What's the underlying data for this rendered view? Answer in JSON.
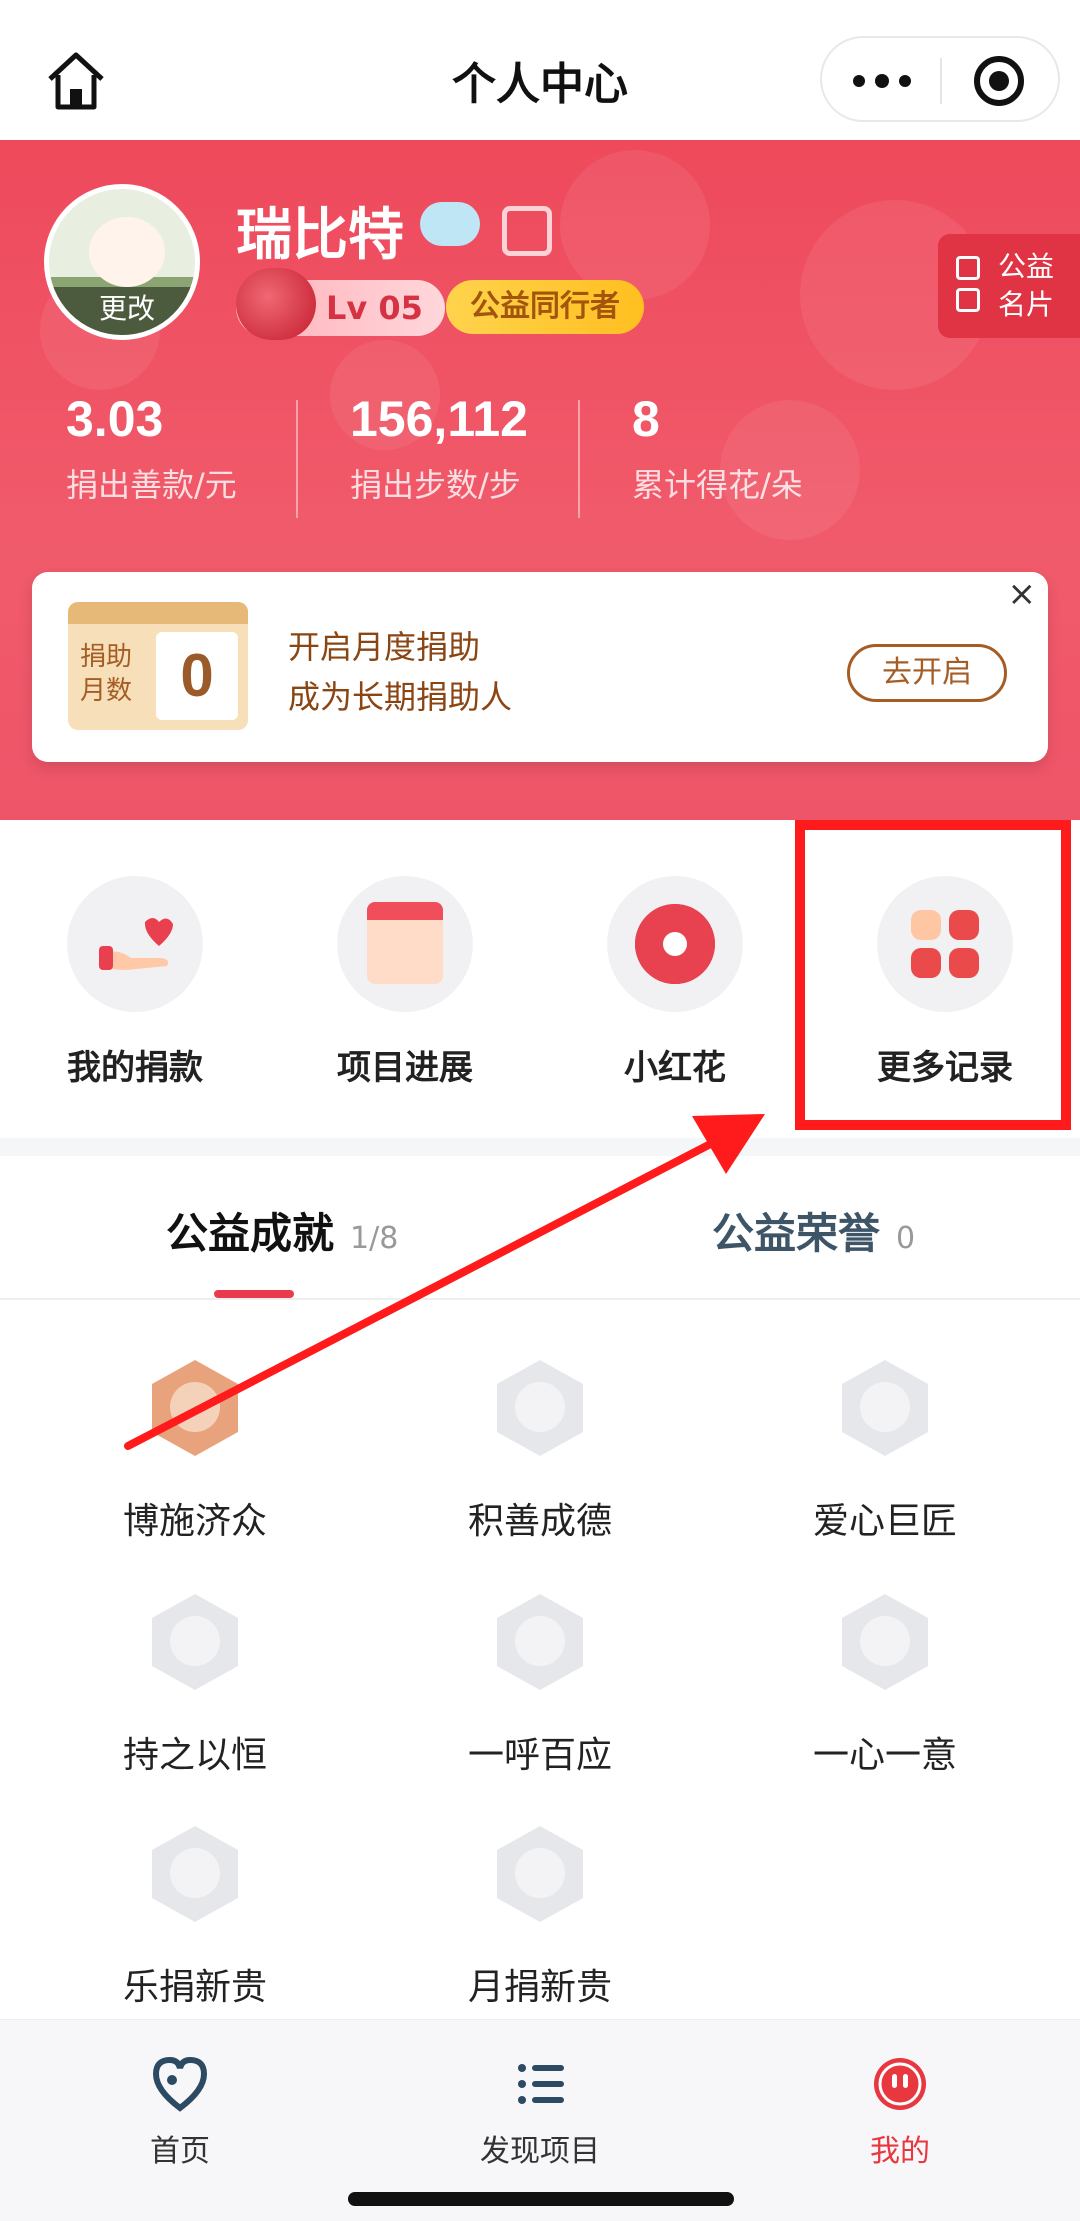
{
  "nav": {
    "title": "个人中心"
  },
  "profile": {
    "username": "瑞比特",
    "avatar_change": "更改",
    "level": "Lv 05",
    "title_badge": "公益同行者",
    "card_button": [
      "公益",
      "名片"
    ]
  },
  "stats": [
    {
      "value": "3.03",
      "label": "捐出善款/元"
    },
    {
      "value": "156,112",
      "label": "捐出步数/步"
    },
    {
      "value": "8",
      "label": "累计得花/朵"
    }
  ],
  "promo": {
    "calendar_label": [
      "捐助",
      "月数"
    ],
    "calendar_value": "0",
    "line1": "开启月度捐助",
    "line2": "成为长期捐助人",
    "button": "去开启",
    "close": "×"
  },
  "quick": [
    {
      "label": "我的捐款",
      "icon": "heart-hand-icon"
    },
    {
      "label": "项目进展",
      "icon": "calendar-icon"
    },
    {
      "label": "小红花",
      "icon": "red-flower-icon"
    },
    {
      "label": "更多记录",
      "icon": "grid-icon"
    }
  ],
  "tabs": [
    {
      "label": "公益成就",
      "count": "1/8",
      "active": true
    },
    {
      "label": "公益荣誉",
      "count": "0",
      "active": false
    }
  ],
  "achievements": [
    {
      "label": "博施济众",
      "unlocked": true
    },
    {
      "label": "积善成德",
      "unlocked": false
    },
    {
      "label": "爱心巨匠",
      "unlocked": false
    },
    {
      "label": "持之以恒",
      "unlocked": false
    },
    {
      "label": "一呼百应",
      "unlocked": false
    },
    {
      "label": "一心一意",
      "unlocked": false
    },
    {
      "label": "乐捐新贵",
      "unlocked": false
    },
    {
      "label": "月捐新贵",
      "unlocked": false
    }
  ],
  "tabbar": [
    {
      "label": "首页",
      "icon": "heart-home-icon",
      "active": false
    },
    {
      "label": "发现项目",
      "icon": "list-icon",
      "active": false
    },
    {
      "label": "我的",
      "icon": "face-icon",
      "active": true
    }
  ],
  "colors": {
    "brand_red": "#ee4a5c",
    "annotation_red": "#ff1b1b",
    "active_tab": "#e8373f"
  }
}
